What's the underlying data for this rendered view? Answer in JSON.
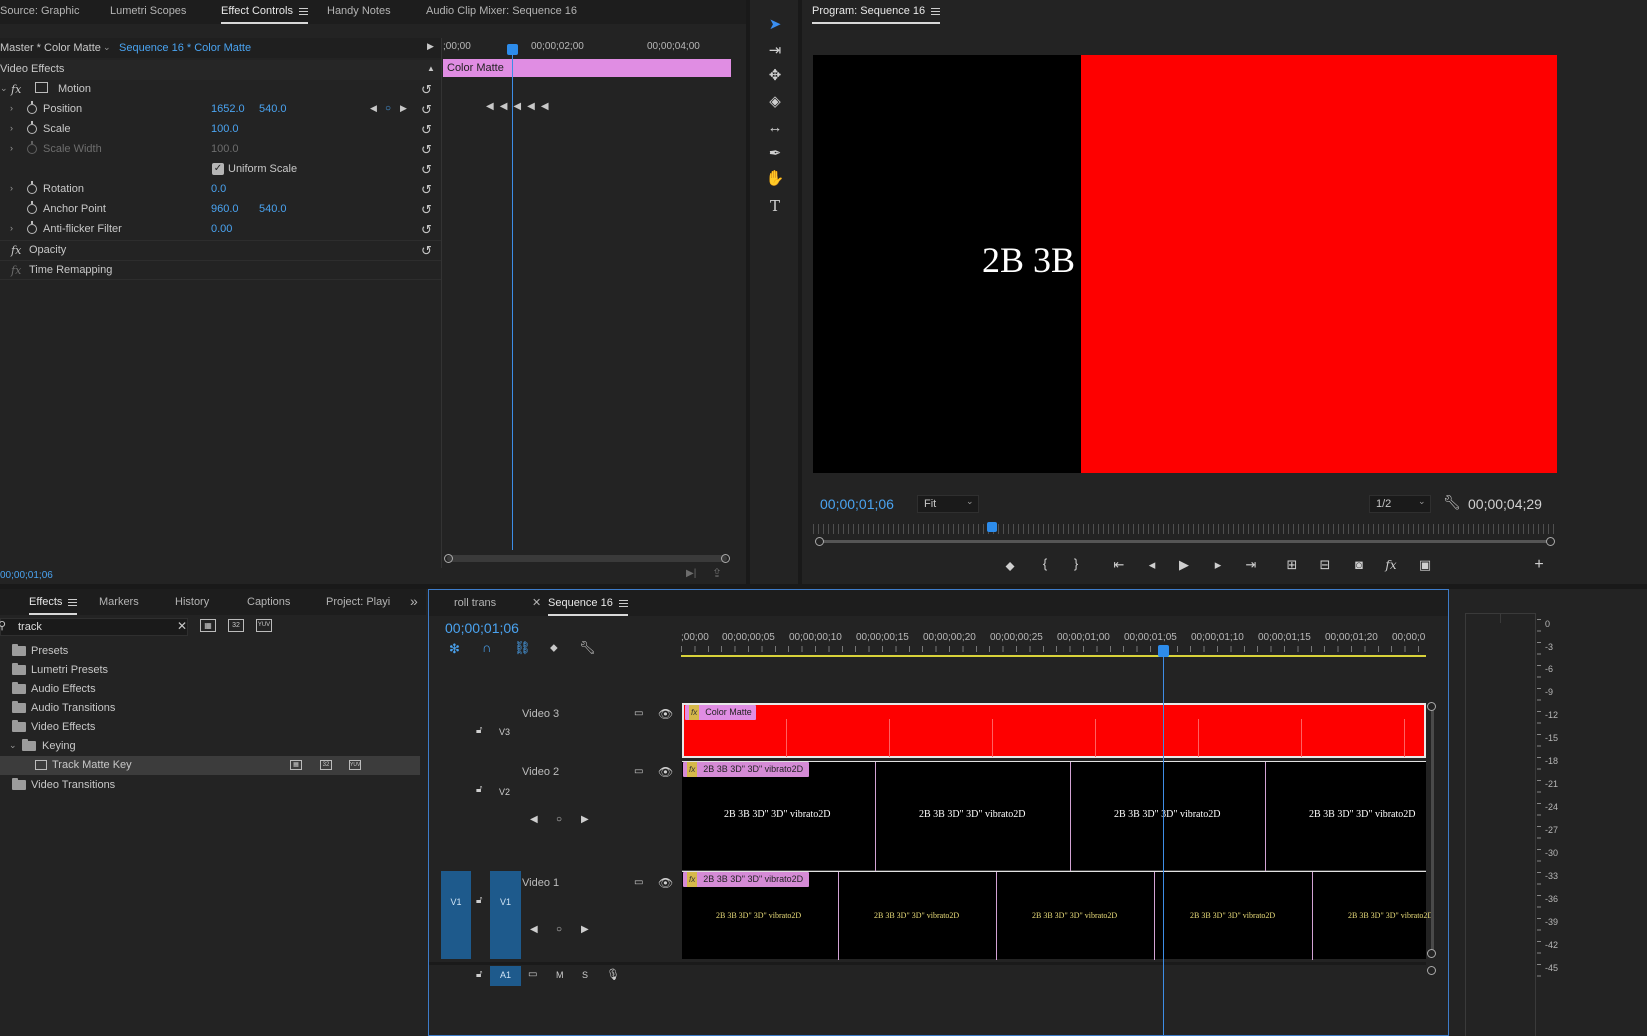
{
  "source_panel": {
    "tabs": [
      "Source: Graphic",
      "Lumetri Scopes",
      "Effect Controls",
      "Handy Notes",
      "Audio Clip Mixer: Sequence 16"
    ],
    "active_tab": "Effect Controls",
    "master_label": "Master * Color Matte",
    "sequence_dropdown": "Sequence 16 * Color Matte",
    "section_title": "Video Effects",
    "motion_label": "Motion",
    "props": {
      "position": {
        "label": "Position",
        "x": "1652.0",
        "y": "540.0"
      },
      "scale": {
        "label": "Scale",
        "value": "100.0"
      },
      "scale_width": {
        "label": "Scale Width",
        "value": "100.0"
      },
      "uniform_scale": {
        "label": "Uniform Scale",
        "checked": true
      },
      "rotation": {
        "label": "Rotation",
        "value": "0.0"
      },
      "anchor": {
        "label": "Anchor Point",
        "x": "960.0",
        "y": "540.0"
      },
      "antiflicker": {
        "label": "Anti-flicker Filter",
        "value": "0.00"
      }
    },
    "opacity_label": "Opacity",
    "time_remap_label": "Time Remapping",
    "ruler": [
      ";00;00",
      "00;00;02;00",
      "00;00;04;00"
    ],
    "clip_label": "Color Matte",
    "timecode": "00;00;01;06"
  },
  "program_monitor": {
    "title": "Program: Sequence 16",
    "frame_text": "2B 3B",
    "timecode": "00;00;01;06",
    "fit": "Fit",
    "resolution": "1/2",
    "duration": "00;00;04;29",
    "colors": {
      "black": "#000000",
      "red": "#fe0000"
    }
  },
  "effects_panel": {
    "tabs": [
      "Effects",
      "Markers",
      "History",
      "Captions",
      "Project: Playi"
    ],
    "active_tab": "Effects",
    "search_value": "track",
    "items": [
      {
        "label": "Presets"
      },
      {
        "label": "Lumetri Presets"
      },
      {
        "label": "Audio Effects"
      },
      {
        "label": "Audio Transitions"
      },
      {
        "label": "Video Effects"
      },
      {
        "label": "Keying"
      },
      {
        "label": "Track Matte Key"
      },
      {
        "label": "Video Transitions"
      }
    ]
  },
  "timeline": {
    "tabs": [
      "roll trans",
      "Sequence 16"
    ],
    "active_tab": "Sequence 16",
    "timecode": "00;00;01;06",
    "ruler": [
      ";00;00",
      "00;00;00;05",
      "00;00;00;10",
      "00;00;00;15",
      "00;00;00;20",
      "00;00;00;25",
      "00;00;01;00",
      "00;00;01;05",
      "00;00;01;10",
      "00;00;01;15",
      "00;00;01;20",
      "00;00;0"
    ],
    "tracks": {
      "v3": {
        "name": "Video 3",
        "id": "V3",
        "clip": "Color Matte"
      },
      "v2": {
        "name": "Video 2",
        "id": "V2",
        "clip": "2B 3B 3D\" 3D\" vibrato2D",
        "frame_text": "2B 3B 3D\" 3D\" vibrato2D"
      },
      "v1": {
        "name": "Video 1",
        "id": "V1",
        "src": "V1",
        "clip": "2B 3B 3D\" 3D\" vibrato2D",
        "frame_text": "2B 3B 3D\" 3D\" vibrato2D"
      },
      "a1": {
        "id": "A1",
        "m": "M",
        "s": "S"
      }
    }
  },
  "audio_meter": {
    "labels": [
      "0",
      "-3",
      "-6",
      "-9",
      "-12",
      "-15",
      "-18",
      "-21",
      "-24",
      "-27",
      "-30",
      "-33",
      "-36",
      "-39",
      "-42",
      "-45"
    ]
  }
}
